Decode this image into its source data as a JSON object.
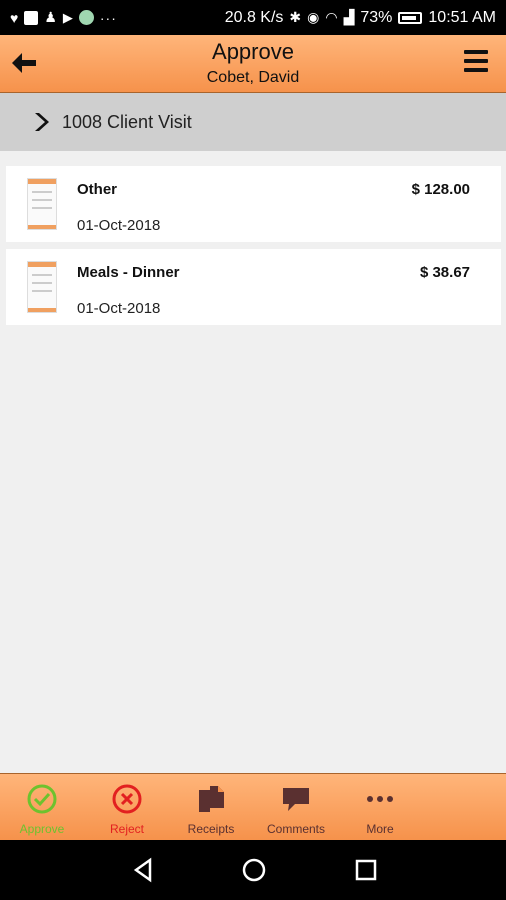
{
  "status_bar": {
    "speed": "20.8 K/s",
    "battery": "73%",
    "time": "10:51 AM"
  },
  "header": {
    "title": "Approve",
    "subtitle": "Cobet, David"
  },
  "section": {
    "title": "1008 Client Visit"
  },
  "expenses": [
    {
      "category": "Other",
      "amount": "$ 128.00",
      "date": "01-Oct-2018"
    },
    {
      "category": "Meals - Dinner",
      "amount": "$ 38.67",
      "date": "01-Oct-2018"
    }
  ],
  "toolbar": {
    "approve": {
      "label": "Approve",
      "color": "#6ec22e"
    },
    "reject": {
      "label": "Reject",
      "color": "#e22020"
    },
    "receipts": {
      "label": "Receipts",
      "color": "#5a3030"
    },
    "comments": {
      "label": "Comments",
      "color": "#5a3030"
    },
    "more": {
      "label": "More",
      "color": "#5a3030"
    }
  }
}
